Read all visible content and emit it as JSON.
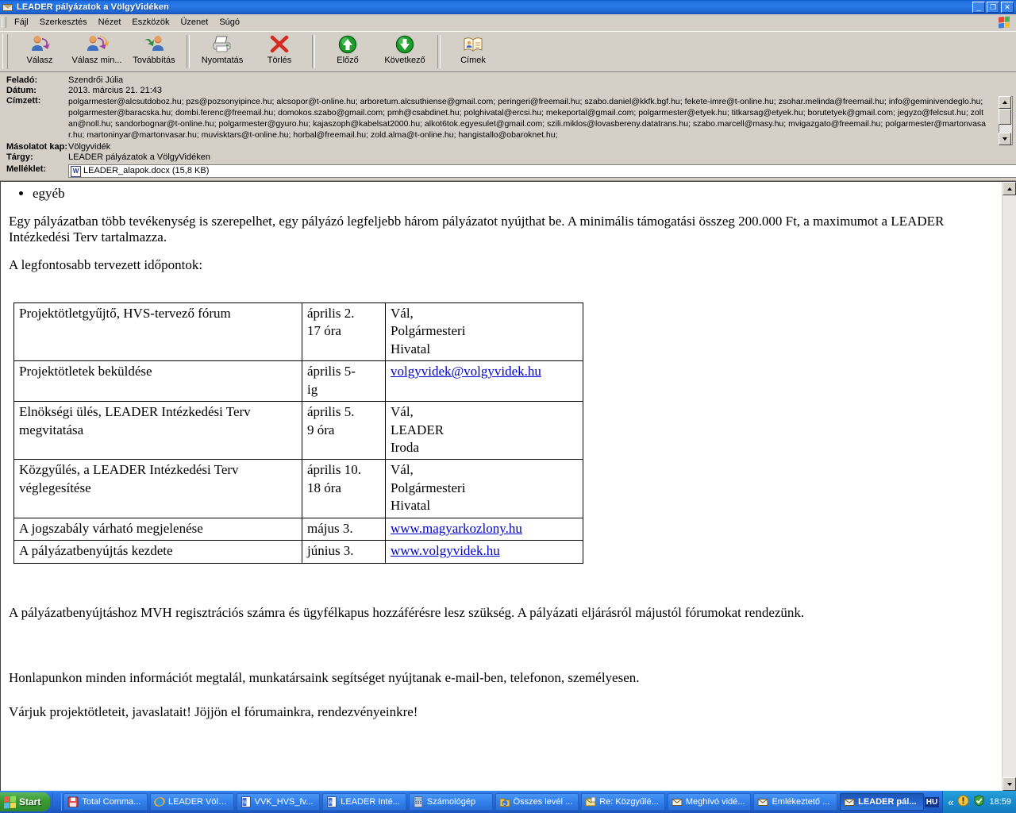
{
  "window": {
    "title": "LEADER pályázatok a VölgyVidéken",
    "icon": "envelope-icon",
    "buttons": {
      "minimize": "_",
      "restore": "❐",
      "close": "✕"
    }
  },
  "menubar": {
    "items": [
      {
        "label": "Fájl",
        "name": "menu-file"
      },
      {
        "label": "Szerkesztés",
        "name": "menu-edit"
      },
      {
        "label": "Nézet",
        "name": "menu-view"
      },
      {
        "label": "Eszközök",
        "name": "menu-tools"
      },
      {
        "label": "Üzenet",
        "name": "menu-message"
      },
      {
        "label": "Súgó",
        "name": "menu-help"
      }
    ]
  },
  "toolbar": {
    "buttons": [
      {
        "label": "Válasz",
        "icon": "reply-icon"
      },
      {
        "label": "Válasz min...",
        "icon": "reply-all-icon"
      },
      {
        "label": "Továbbítás",
        "icon": "forward-icon"
      },
      {
        "label": "Nyomtatás",
        "icon": "printer-icon"
      },
      {
        "label": "Törlés",
        "icon": "delete-x-icon"
      },
      {
        "label": "Előző",
        "icon": "previous-up-arrow-icon"
      },
      {
        "label": "Következő",
        "icon": "next-down-arrow-icon"
      },
      {
        "label": "Címek",
        "icon": "address-book-icon"
      }
    ]
  },
  "headers": {
    "from_label": "Feladó:",
    "from_value": "Szendrői Júlia",
    "date_label": "Dátum:",
    "date_value": "2013. március 21. 21:43",
    "to_label": "Címzett:",
    "to_value": "polgarmester@alcsutdoboz.hu; pzs@pozsonyipince.hu; alcsopor@t-online.hu; arboretum.alcsuthiense@gmail.com; peringeri@freemail.hu; szabo.daniel@kkfk.bgf.hu; fekete-imre@t-online.hu; zsohar.melinda@freemail.hu; info@geminivendeglo.hu; polgarmester@baracska.hu; dombi.ferenc@freemail.hu; domokos.szabo@gmail.com; pmh@csabdinet.hu; polghivatal@ercsi.hu; mekeportal@gmail.com; polgarmester@etyek.hu; titkarsag@etyek.hu; borutetyek@gmail.com; jegyzo@felcsut.hu; zoltan@noll.hu; sandorbognar@t-online.hu; polgarmester@gyuro.hu; kajaszoph@kabelsat2000.hu; alkot6tok.egyesulet@gmail.com; szili.miklos@lovasbereny.datatrans.hu; szabo.marcell@masy.hu; mvigazgato@freemail.hu; polgarmester@martonvasar.hu; martoninyar@martonvasar.hu; muvisktars@t-online.hu; horbal@freemail.hu; zold.alma@t-online.hu; hangistallo@obaroknet.hu;",
    "cc_label": "Másolatot kap:",
    "cc_value": "Völgyvidék",
    "subject_label": "Tárgy:",
    "subject_value": "LEADER pályázatok a VölgyVidéken",
    "attachment_label": "Melléklet:",
    "attachment_value": "LEADER_alapok.docx (15,8 KB)",
    "attachment_icon": "word-document-icon"
  },
  "message": {
    "bullet_item": "egyéb",
    "para1": " Egy pályázatban több tevékenység is szerepelhet, egy pályázó legfeljebb három pályázatot nyújthat be. A minimális támogatási összeg 200.000 Ft, a maximumot a LEADER Intézkedési Terv tartalmazza.",
    "para2": "A legfontosabb tervezett időpontok:",
    "para3": "A pályázatbenyújtáshoz MVH regisztrációs számra és ügyfélkapus hozzáférésre lesz szükség. A pályázati eljárásról májustól fórumokat rendezünk.",
    "para4": "Honlapunkon minden információt megtalál, munkatársaink segítséget nyújtanak e-mail-ben, telefonon, személyesen.",
    "para5": "Várjuk projektötleteit, javaslatait! Jöjjön el fórumainkra, rendezvényeinkre!",
    "table": {
      "rows": [
        {
          "event": "Projektötletgyűjtő, HVS-tervező fórum",
          "date": "április 2.\n17 óra",
          "place": "Vál,\nPolgármesteri\nHivatal",
          "link": null
        },
        {
          "event": "Projektötletek beküldése",
          "date": "április 5-\nig",
          "place": "volgyvidek@volgyvidek.hu",
          "link": true
        },
        {
          "event": "Elnökségi ülés, LEADER Intézkedési Terv megvitatása",
          "date": "április 5.\n9 óra",
          "place": "Vál,\nLEADER\nIroda",
          "link": null
        },
        {
          "event": "Közgyűlés, a LEADER Intézkedési Terv véglegesítése",
          "date": "április 10.\n18 óra",
          "place": "Vál,\nPolgármesteri\nHivatal",
          "link": null
        },
        {
          "event": "A jogszabály várható megjelenése",
          "date": "május 3.",
          "place": "www.magyarkozlony.hu",
          "link": true
        },
        {
          "event": "A pályázatbenyújtás kezdete",
          "date": "június 3.",
          "place": "www.volgyvidek.hu",
          "link": true
        }
      ]
    }
  },
  "taskbar": {
    "start_label": "Start",
    "tasks": [
      {
        "label": "Total Comma...",
        "icon": "floppy-save-icon",
        "active": false
      },
      {
        "label": "LEADER Völg...",
        "icon": "internet-explorer-icon",
        "active": false
      },
      {
        "label": "VVK_HVS_fv...",
        "icon": "word-document-icon",
        "active": false
      },
      {
        "label": "LEADER Inté...",
        "icon": "word-document-icon",
        "active": false
      },
      {
        "label": "Számológép",
        "icon": "calculator-icon",
        "active": false
      },
      {
        "label": "Összes levél ...",
        "icon": "outlook-folder-icon",
        "active": false
      },
      {
        "label": "Re: Közgyűlé...",
        "icon": "mail-open-icon",
        "active": false
      },
      {
        "label": "Meghívó vidé...",
        "icon": "envelope-icon",
        "active": false
      },
      {
        "label": "Emlékeztető ...",
        "icon": "envelope-icon",
        "active": false
      },
      {
        "label": "LEADER pál...",
        "icon": "envelope-icon",
        "active": true
      }
    ],
    "language": "HU",
    "tray_chevron": "«",
    "clock": "18:59"
  },
  "colors": {
    "titlebar_blue": "#2a7ae8",
    "face": "#d4d0c8",
    "link": "#0000cc",
    "taskbar_blue": "#2468d8",
    "start_green": "#3d9b35"
  }
}
